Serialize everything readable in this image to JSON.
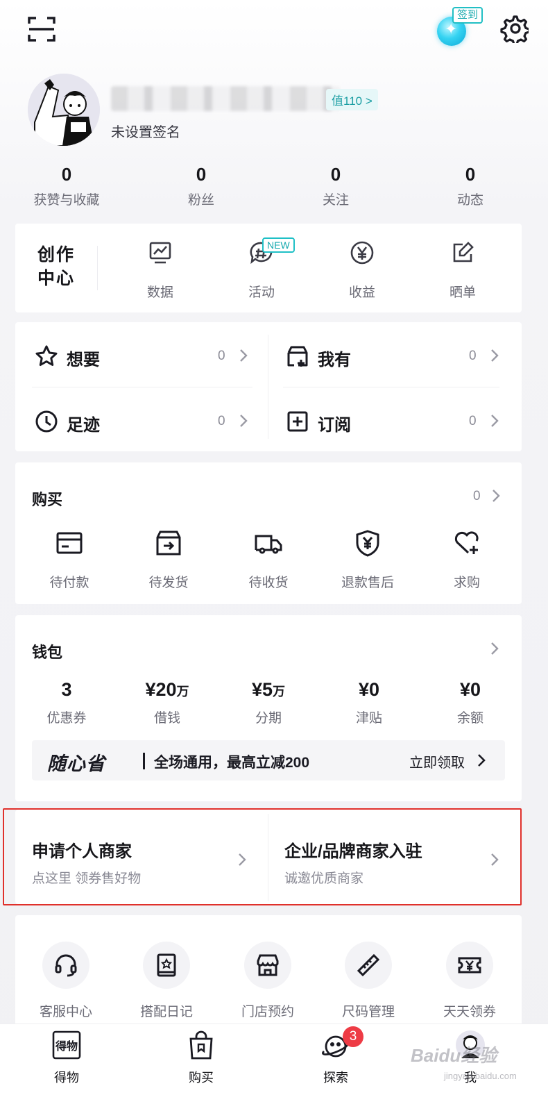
{
  "header": {
    "checkin_label": "签到"
  },
  "profile": {
    "level_chip": "值110 >",
    "signature": "未设置签名",
    "stats": [
      {
        "value": "0",
        "label": "获赞与收藏"
      },
      {
        "value": "0",
        "label": "粉丝"
      },
      {
        "value": "0",
        "label": "关注"
      },
      {
        "value": "0",
        "label": "动态"
      }
    ]
  },
  "creator": {
    "title": "创作中心",
    "new_badge": "NEW",
    "items": [
      {
        "label": "数据",
        "icon": "chart-icon"
      },
      {
        "label": "活动",
        "icon": "hashtag-chat-icon"
      },
      {
        "label": "收益",
        "icon": "yen-circle-icon"
      },
      {
        "label": "晒单",
        "icon": "edit-note-icon"
      }
    ]
  },
  "mine": [
    {
      "label": "想要",
      "count": "0",
      "icon": "star-icon"
    },
    {
      "label": "我有",
      "count": "0",
      "icon": "box-plus-icon"
    },
    {
      "label": "足迹",
      "count": "0",
      "icon": "clock-icon"
    },
    {
      "label": "订阅",
      "count": "0",
      "icon": "plus-square-icon"
    }
  ],
  "purchase": {
    "title": "购买",
    "count": "0",
    "items": [
      {
        "label": "待付款",
        "icon": "card-icon"
      },
      {
        "label": "待发货",
        "icon": "package-icon"
      },
      {
        "label": "待收货",
        "icon": "truck-icon"
      },
      {
        "label": "退款售后",
        "icon": "shield-yen-icon"
      },
      {
        "label": "求购",
        "icon": "heart-plus-icon"
      }
    ]
  },
  "wallet": {
    "title": "钱包",
    "items": [
      {
        "prefix": "",
        "value": "3",
        "unit": "",
        "label": "优惠券"
      },
      {
        "prefix": "¥",
        "value": "20",
        "unit": "万",
        "label": "借钱"
      },
      {
        "prefix": "¥",
        "value": "5",
        "unit": "万",
        "label": "分期"
      },
      {
        "prefix": "¥",
        "value": "0",
        "unit": "",
        "label": "津贴"
      },
      {
        "prefix": "¥",
        "value": "0",
        "unit": "",
        "label": "余额"
      }
    ],
    "promo": {
      "logo": "随心省",
      "text": "全场通用，最高立减200",
      "cta": "立即领取"
    }
  },
  "merchant": [
    {
      "title": "申请个人商家",
      "subtitle": "点这里 领券售好物"
    },
    {
      "title": "企业/品牌商家入驻",
      "subtitle": "诚邀优质商家"
    }
  ],
  "services": [
    {
      "label": "客服中心",
      "icon": "headset-icon"
    },
    {
      "label": "搭配日记",
      "icon": "diary-icon"
    },
    {
      "label": "门店预约",
      "icon": "store-icon"
    },
    {
      "label": "尺码管理",
      "icon": "ruler-icon"
    },
    {
      "label": "天天领券",
      "icon": "ticket-icon"
    }
  ],
  "tabbar": {
    "items": [
      {
        "label": "得物",
        "icon": "dewu-logo-icon"
      },
      {
        "label": "购买",
        "icon": "shopping-bag-icon"
      },
      {
        "label": "探索",
        "icon": "planet-icon"
      },
      {
        "label": "我",
        "icon": "avatar-tab-icon"
      }
    ],
    "explore_badge": "3",
    "logo_text": "得物"
  },
  "watermark": {
    "text": "Baidu经验",
    "sub": "jingyan.baidu.com"
  },
  "colors": {
    "accent": "#1fc0c6",
    "highlight_border": "#e0302b",
    "badge_red": "#ee3b45"
  }
}
